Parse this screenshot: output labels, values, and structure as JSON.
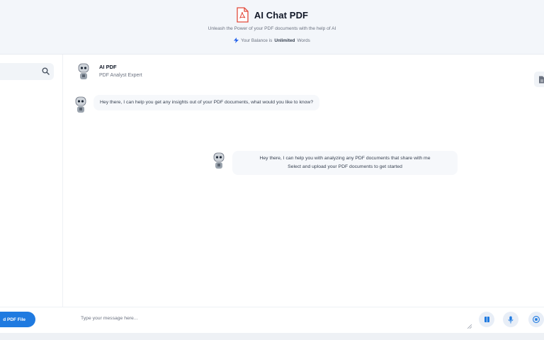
{
  "app": {
    "title": "AI Chat PDF",
    "subtitle": "Unleash the Power of your PDF documents with the help of AI",
    "balance_prefix": "Your Balance is",
    "balance_value": "Unlimited",
    "balance_suffix": "Words"
  },
  "chat_header": {
    "name": "AI PDF",
    "role": "PDF Analyst Expert"
  },
  "messages": [
    {
      "text": "Hey there, I can help you get any insights out of your PDF documents, what would you like to know?"
    },
    {
      "line1": "Hey there, I can help you with analyzing any PDF documents that share with me",
      "line2": "Select and upload your PDF documents to get started"
    }
  ],
  "composer": {
    "upload_label": "d PDF File",
    "placeholder": "Type your message here..."
  },
  "icons": {
    "brand": "pdf-file-icon",
    "balance": "lightning-bolt-icon",
    "search": "search-icon",
    "document": "document-icon",
    "book": "book-icon",
    "mic": "microphone-icon",
    "stop": "stop-icon"
  },
  "colors": {
    "accent": "#1f7ae0",
    "pdf_red": "#e24a3b"
  }
}
